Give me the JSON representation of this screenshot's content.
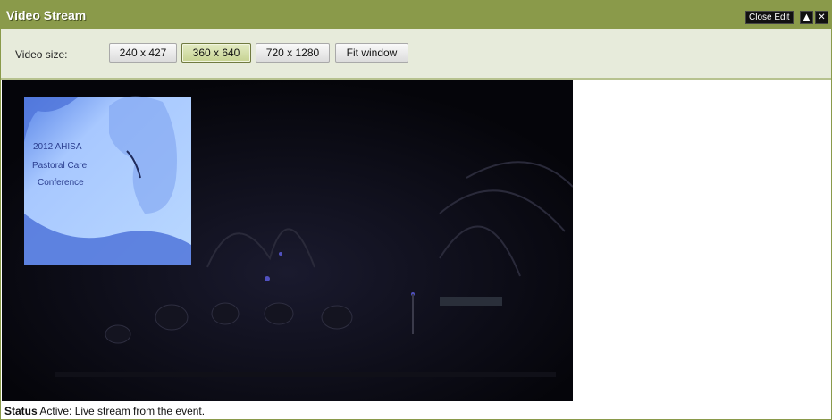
{
  "window": {
    "title": "Video Stream",
    "close_edit_label": "Close Edit",
    "collapse_icon": "▲",
    "close_icon": "✕"
  },
  "toolbar": {
    "label": "Video size:",
    "buttons": [
      {
        "label": "240 x 427",
        "active": false
      },
      {
        "label": "360 x 640",
        "active": true
      },
      {
        "label": "720 x 1280",
        "active": false
      },
      {
        "label": "Fit window",
        "active": false
      }
    ]
  },
  "video": {
    "slide_lines": [
      "2012 AHISA",
      "Pastoral Care",
      "Conference"
    ]
  },
  "status": {
    "label": "Status",
    "text": "Active: Live stream from the event."
  },
  "colors": {
    "title_bar": "#8a9a4a",
    "toolbar_bg": "#e7ebdb",
    "active_button": "#c6d291",
    "video_bg": "#05050a",
    "slide_blue": "#a8c8ff"
  }
}
